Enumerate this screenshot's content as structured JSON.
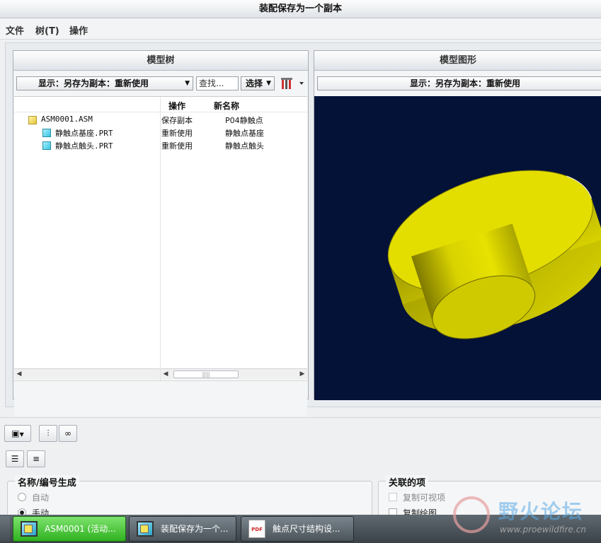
{
  "window": {
    "title": "装配保存为一个副本"
  },
  "menu": {
    "file": "文件",
    "tree": "树(T)",
    "action": "操作"
  },
  "model_tree": {
    "title": "模型树",
    "display_dropdown": "显示：另存为副本：重新使用",
    "search_placeholder": "查找...",
    "select_label": "选择",
    "columns": {
      "action": "操作",
      "new_name": "新名称"
    },
    "rows": [
      {
        "name": "ASM0001.ASM",
        "action": "保存副本",
        "new_name": "P04静触点"
      },
      {
        "name": "静触点基座.PRT",
        "action": "重新使用",
        "new_name": "静触点基座"
      },
      {
        "name": "静触点触头.PRT",
        "action": "重新使用",
        "new_name": "静触点触头"
      }
    ]
  },
  "model_graphics": {
    "title": "模型图形",
    "display_dropdown": "显示：另存为副本：重新使用",
    "background_color": "#041238",
    "model_color": "#e2dc00"
  },
  "name_group": {
    "title": "名称/编号生成",
    "auto_label": "自动",
    "manual_label": "手动",
    "selected": "manual"
  },
  "related_group": {
    "title": "关联的项",
    "copy_views_label": "复制可视项",
    "copy_drawings_label": "复制绘图"
  },
  "taskbar": {
    "items": [
      {
        "label": "ASM0001 (活动...",
        "active": true
      },
      {
        "label": "装配保存为一个...",
        "active": false
      },
      {
        "label": "触点尺寸结构设...",
        "active": false
      }
    ]
  },
  "watermark": {
    "text_cn": "野火论坛",
    "url": "www.proewildfire.cn"
  }
}
